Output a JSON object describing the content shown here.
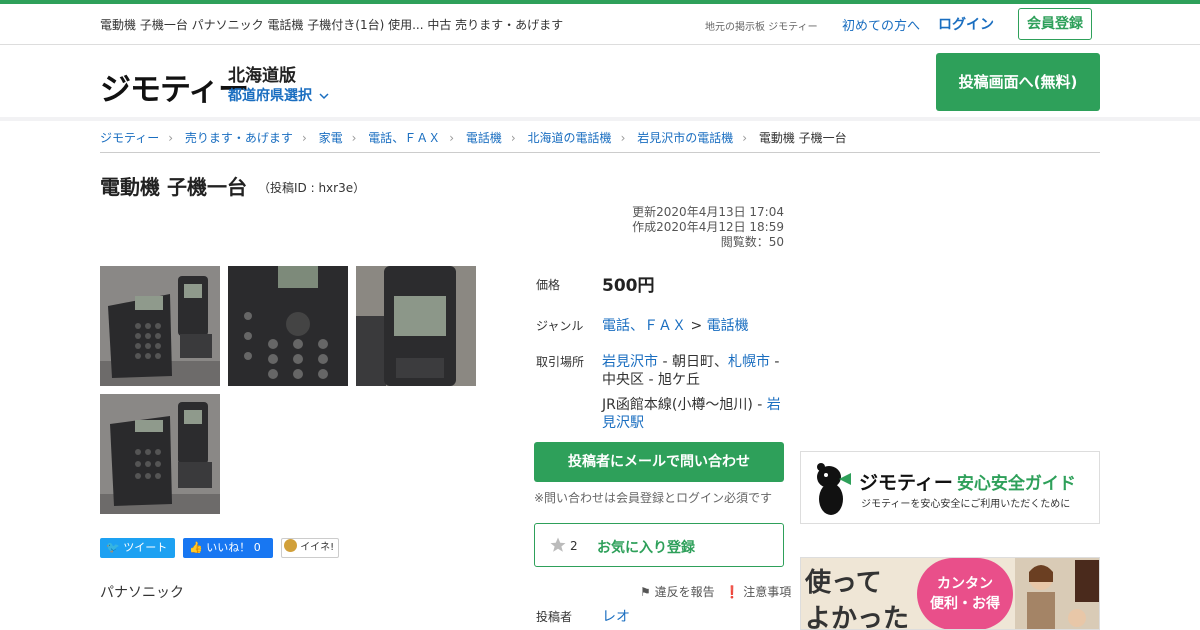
{
  "header": {
    "description": "電動機 子機一台 パナソニック 電話機 子機付き(1台) 使用... 中古 売ります・あげます",
    "local_board": "地元の掲示板 ジモティー",
    "first_time": "初めての方へ",
    "login": "ログイン",
    "register": "会員登録"
  },
  "brand": {
    "logo": "ジモティー",
    "region": "北海道版",
    "pref_select": "都道府県選択",
    "post_button": "投稿画面へ(無料)"
  },
  "breadcrumbs": [
    "ジモティー",
    "売ります・あげます",
    "家電",
    "電話、ＦＡＸ",
    "電話機",
    "北海道の電話機",
    "岩見沢市の電話機",
    "電動機 子機一台"
  ],
  "post": {
    "title": "電動機 子機一台",
    "post_id": "（投稿ID : hxr3e）",
    "updated": "更新2020年4月13日 17:04",
    "created": "作成2020年4月12日 18:59",
    "views": "閲覧数：50",
    "maker": "パナソニック"
  },
  "social": {
    "tweet": "ツイート",
    "like": "いいね！ 0",
    "iine": "イイネ!"
  },
  "details": {
    "price_label": "価格",
    "price": "500円",
    "genre_label": "ジャンル",
    "genre_1": "電話、ＦＡＸ",
    "genre_sep": ">",
    "genre_2": "電話機",
    "place_label": "取引場所",
    "place_city": "岩見沢市",
    "place_town": " - 朝日町、",
    "place_city2": "札幌市",
    "place_rest": " - 中央区 - 旭ケ丘",
    "station_line": "JR函館本線(小樽～旭川) - ",
    "station": "岩見沢駅",
    "contact_button": "投稿者にメールで問い合わせ",
    "contact_note": "※問い合わせは会員登録とログイン必須です",
    "fav_count": "2",
    "fav_label": "お気に入り登録",
    "report": "違反を報告",
    "caution": "注意事項",
    "poster_label": "投稿者",
    "poster_name": "レオ"
  },
  "sidebar": {
    "guide_title_brand": "ジモティー",
    "guide_title": "安心安全ガイド",
    "guide_sub": "ジモティーを安心安全にご利用いただくために",
    "ad_text_1": "使って",
    "ad_text_2": "よかった",
    "ad_badge_1": "カンタン",
    "ad_badge_2": "便利・お得"
  },
  "colors": {
    "brand_green": "#2ea05a",
    "link_blue": "#1a6ec0",
    "twitter_blue": "#1da1f2",
    "facebook_blue": "#1877f2"
  }
}
